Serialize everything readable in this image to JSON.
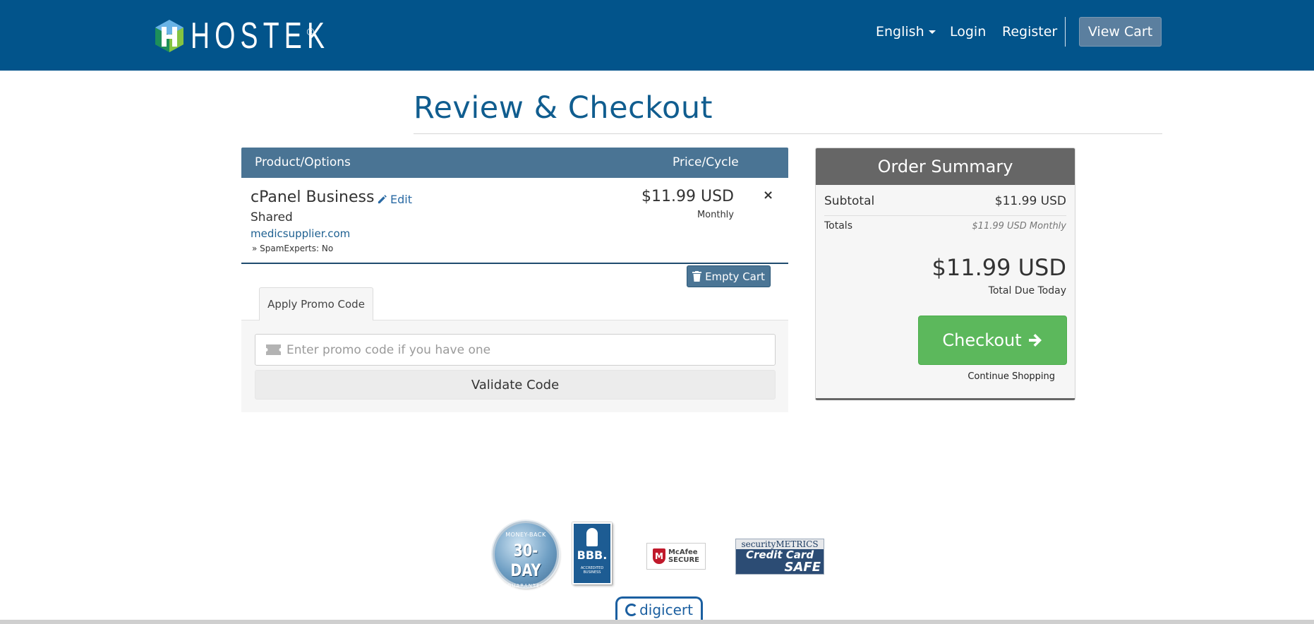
{
  "header": {
    "logo_text": "HOSTEK",
    "logo_mark": "®",
    "language": "English",
    "login": "Login",
    "register": "Register",
    "view_cart": "View Cart"
  },
  "page_title": "Review & Checkout",
  "cart": {
    "columns": [
      "Product/Options",
      "Price/Cycle"
    ],
    "item": {
      "name": "cPanel Business",
      "edit": "Edit",
      "group": "Shared",
      "domain": "medicsupplier.com",
      "option": "» SpamExperts: No",
      "price": "$11.99 USD",
      "cycle": "Monthly",
      "remove_icon": "×"
    },
    "empty_cart": "Empty Cart"
  },
  "promo": {
    "tab_label": "Apply Promo Code",
    "placeholder": "Enter promo code if you have one",
    "validate": "Validate Code"
  },
  "summary": {
    "title": "Order Summary",
    "subtotal_label": "Subtotal",
    "subtotal_value": "$11.99 USD",
    "totals_label": "Totals",
    "totals_value": "$11.99 USD Monthly",
    "due_amount": "$11.99 USD",
    "due_label": "Total Due Today",
    "checkout": "Checkout",
    "continue": "Continue Shopping"
  },
  "badges": {
    "money_back": {
      "top": "MONEY-BACK",
      "main": "30-DAY",
      "bottom": "GUARANTEE"
    },
    "bbb": {
      "main": "BBB.",
      "sub": "ACCREDITED BUSINESS"
    },
    "mcafee": {
      "line1": "McAfee",
      "line2": "SECURE"
    },
    "security_metrics": {
      "line1": "securityMETRICS",
      "line2": "Credit Card",
      "line3": "SAFE"
    },
    "digicert": "digicert"
  },
  "colors": {
    "header_bg": "#02548b",
    "table_head": "#4a7494",
    "checkout_green": "#5cb85c",
    "summary_head": "#666666",
    "title_blue": "#105d8f"
  }
}
